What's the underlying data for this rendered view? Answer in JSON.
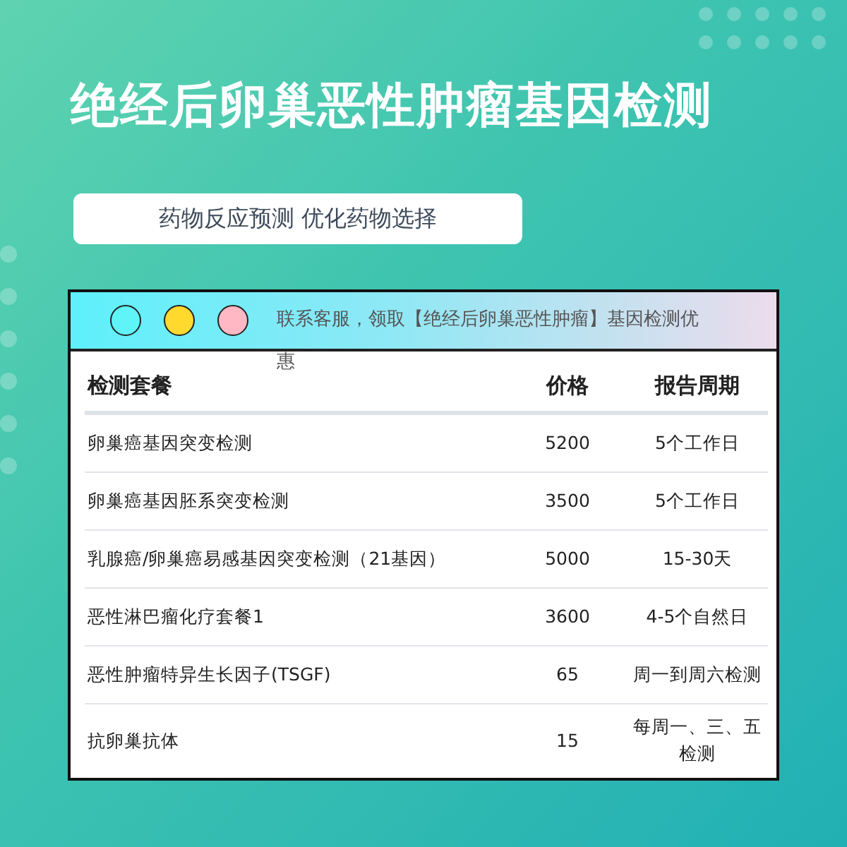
{
  "title": "绝经后卵巢恶性肿瘤基因检测",
  "subtitle": "药物反应预测 优化药物选择",
  "notice": "联系客服，领取【绝经后卵巢恶性肿瘤】基因检测优惠",
  "table": {
    "columns": [
      "检测套餐",
      "价格",
      "报告周期"
    ],
    "rows": [
      {
        "name": "卵巢癌基因突变检测",
        "price": "5200",
        "period": "5个工作日"
      },
      {
        "name": "卵巢癌基因胚系突变检测",
        "price": "3500",
        "period": "5个工作日"
      },
      {
        "name": "乳腺癌/卵巢癌易感基因突变检测（21基因）",
        "price": "5000",
        "period": "15-30天"
      },
      {
        "name": "恶性淋巴瘤化疗套餐1",
        "price": "3600",
        "period": "4-5个自然日"
      },
      {
        "name": "恶性肿瘤特异生长因子(TSGF)",
        "price": "65",
        "period": "周一到周六检测"
      },
      {
        "name": "抗卵巢抗体",
        "price": "15",
        "period": "每周一、三、五检测"
      }
    ]
  }
}
